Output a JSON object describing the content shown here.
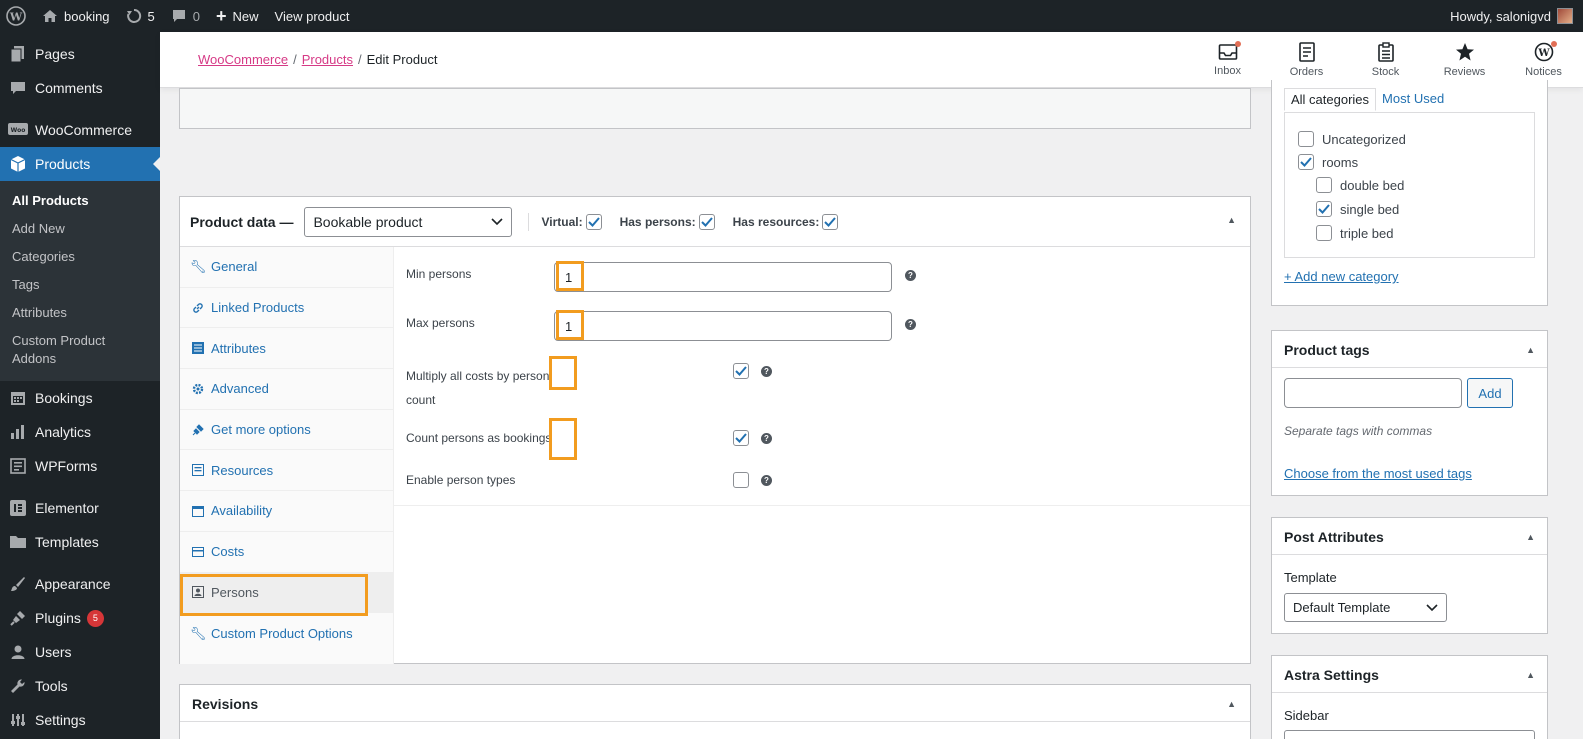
{
  "admin_bar": {
    "site_name": "booking",
    "updates_count": "5",
    "comments_count": "0",
    "new_label": "New",
    "view_label": "View product",
    "howdy": "Howdy, salonigvd"
  },
  "sidebar": {
    "items_top": [
      {
        "label": "Pages",
        "icon": "pages-icon"
      },
      {
        "label": "Comments",
        "icon": "comments-icon"
      }
    ],
    "woocommerce": "WooCommerce",
    "products": "Products",
    "submenu": [
      "All Products",
      "Add New",
      "Categories",
      "Tags",
      "Attributes",
      "Custom Product Addons"
    ],
    "items_bottom": [
      {
        "label": "Bookings"
      },
      {
        "label": "Analytics"
      },
      {
        "label": "WPForms"
      },
      {
        "label": "Elementor"
      },
      {
        "label": "Templates"
      },
      {
        "label": "Appearance"
      },
      {
        "label": "Plugins",
        "badge": "5"
      },
      {
        "label": "Users"
      },
      {
        "label": "Tools"
      },
      {
        "label": "Settings"
      }
    ]
  },
  "header": {
    "breadcrumb": [
      "WooCommerce",
      "Products",
      "Edit Product"
    ],
    "tools": [
      "Inbox",
      "Orders",
      "Stock",
      "Reviews",
      "Notices"
    ]
  },
  "product_data": {
    "title": "Product data —",
    "type_select": "Bookable product",
    "virtual_label": "Virtual:",
    "has_persons_label": "Has persons:",
    "has_resources_label": "Has resources:",
    "tabs": [
      "General",
      "Linked Products",
      "Attributes",
      "Advanced",
      "Get more options",
      "Resources",
      "Availability",
      "Costs",
      "Persons",
      "Custom Product Options"
    ],
    "active_tab": "Persons",
    "fields": {
      "min_persons_label": "Min persons",
      "min_persons_value": "1",
      "max_persons_label": "Max persons",
      "max_persons_value": "1",
      "multiply_label_1": "Multiply all costs by person",
      "multiply_label_2": "count",
      "count_label": "Count persons as bookings",
      "enable_types_label": "Enable person types",
      "help_glyph": "?"
    }
  },
  "revisions": {
    "title": "Revisions"
  },
  "categories": {
    "tab_all": "All categories",
    "tab_most_used": "Most Used",
    "items": [
      {
        "label": "Uncategorized",
        "checked": false
      },
      {
        "label": "rooms",
        "checked": true
      },
      {
        "label": "double bed",
        "checked": false
      },
      {
        "label": "single bed",
        "checked": true
      },
      {
        "label": "triple bed",
        "checked": false
      }
    ],
    "add_new": "+ Add new category"
  },
  "tags": {
    "title": "Product tags",
    "add_button": "Add",
    "hint": "Separate tags with commas",
    "choose_link": "Choose from the most used tags"
  },
  "post_attributes": {
    "title": "Post Attributes",
    "template_label": "Template",
    "template_value": "Default Template"
  },
  "astra": {
    "title": "Astra Settings",
    "sidebar_label": "Sidebar"
  },
  "colors": {
    "accent": "#2271b1",
    "highlight": "#f29c1f",
    "admin_dark": "#1d2327",
    "breadcrumb_link": "#d63a86"
  }
}
